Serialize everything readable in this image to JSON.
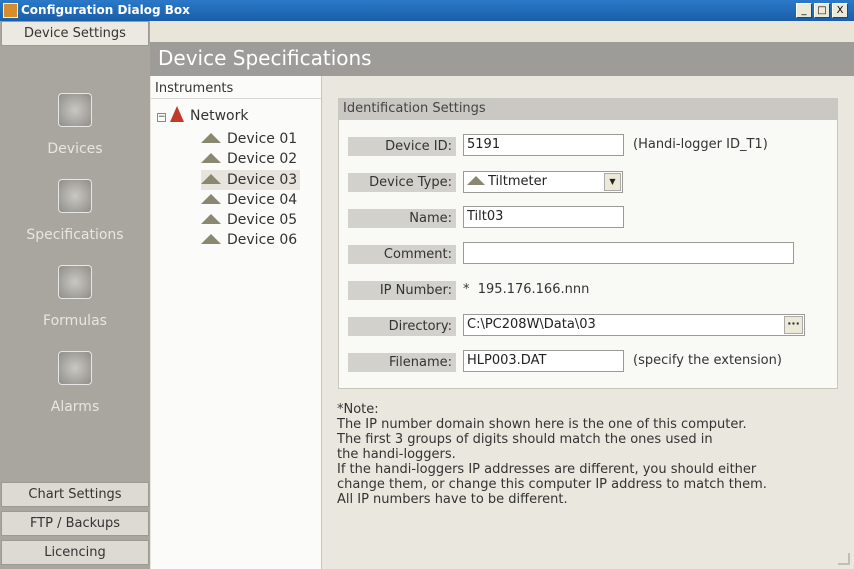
{
  "window": {
    "title": "Configuration Dialog Box",
    "buttons": {
      "minimize": "_",
      "maximize": "□",
      "close": "X"
    }
  },
  "sidebar": {
    "top_button": "Device Settings",
    "nav": [
      {
        "label": "Devices",
        "icon": "devices-icon"
      },
      {
        "label": "Specifications",
        "icon": "specifications-icon"
      },
      {
        "label": "Formulas",
        "icon": "formulas-icon"
      },
      {
        "label": "Alarms",
        "icon": "alarms-icon"
      }
    ],
    "bottom_buttons": [
      "Chart Settings",
      "FTP / Backups",
      "Licencing"
    ]
  },
  "header": {
    "title": "Device Specifications"
  },
  "tree": {
    "heading": "Instruments",
    "root": "Network",
    "expander": "−",
    "devices": [
      "Device 01",
      "Device 02",
      "Device 03",
      "Device 04",
      "Device 05",
      "Device 06"
    ],
    "selected": "Device 03"
  },
  "form": {
    "group_title": "Identification Settings",
    "device_id": {
      "label": "Device ID:",
      "value": "5191",
      "note": "(Handi-logger ID_T1)"
    },
    "device_type": {
      "label": "Device Type:",
      "value": "Tiltmeter",
      "arrow": "▼"
    },
    "name": {
      "label": "Name:",
      "value": "Tilt03"
    },
    "comment": {
      "label": "Comment:",
      "value": ""
    },
    "ip_number": {
      "label": "IP Number:",
      "value": "*  195.176.166.nnn"
    },
    "directory": {
      "label": "Directory:",
      "value": "C:\\PC208W\\Data\\03",
      "browse": "···"
    },
    "filename": {
      "label": "Filename:",
      "value": "HLP003.DAT",
      "note": "(specify the extension)"
    }
  },
  "note": "*Note:\nThe IP number domain shown here is the one of this computer.\nThe first 3 groups of digits should match the ones used in\nthe handi-loggers.\nIf the handi-loggers IP addresses are different, you should either\nchange them, or change this computer IP address to match them.\nAll IP numbers have to be different.",
  "colors": {
    "titlebar": "#1a5ea8",
    "sidebar": "#a9a6a0",
    "header": "#9d9c98",
    "tree_triangle": "#8a8870",
    "network_icon": "#c23a2a"
  }
}
